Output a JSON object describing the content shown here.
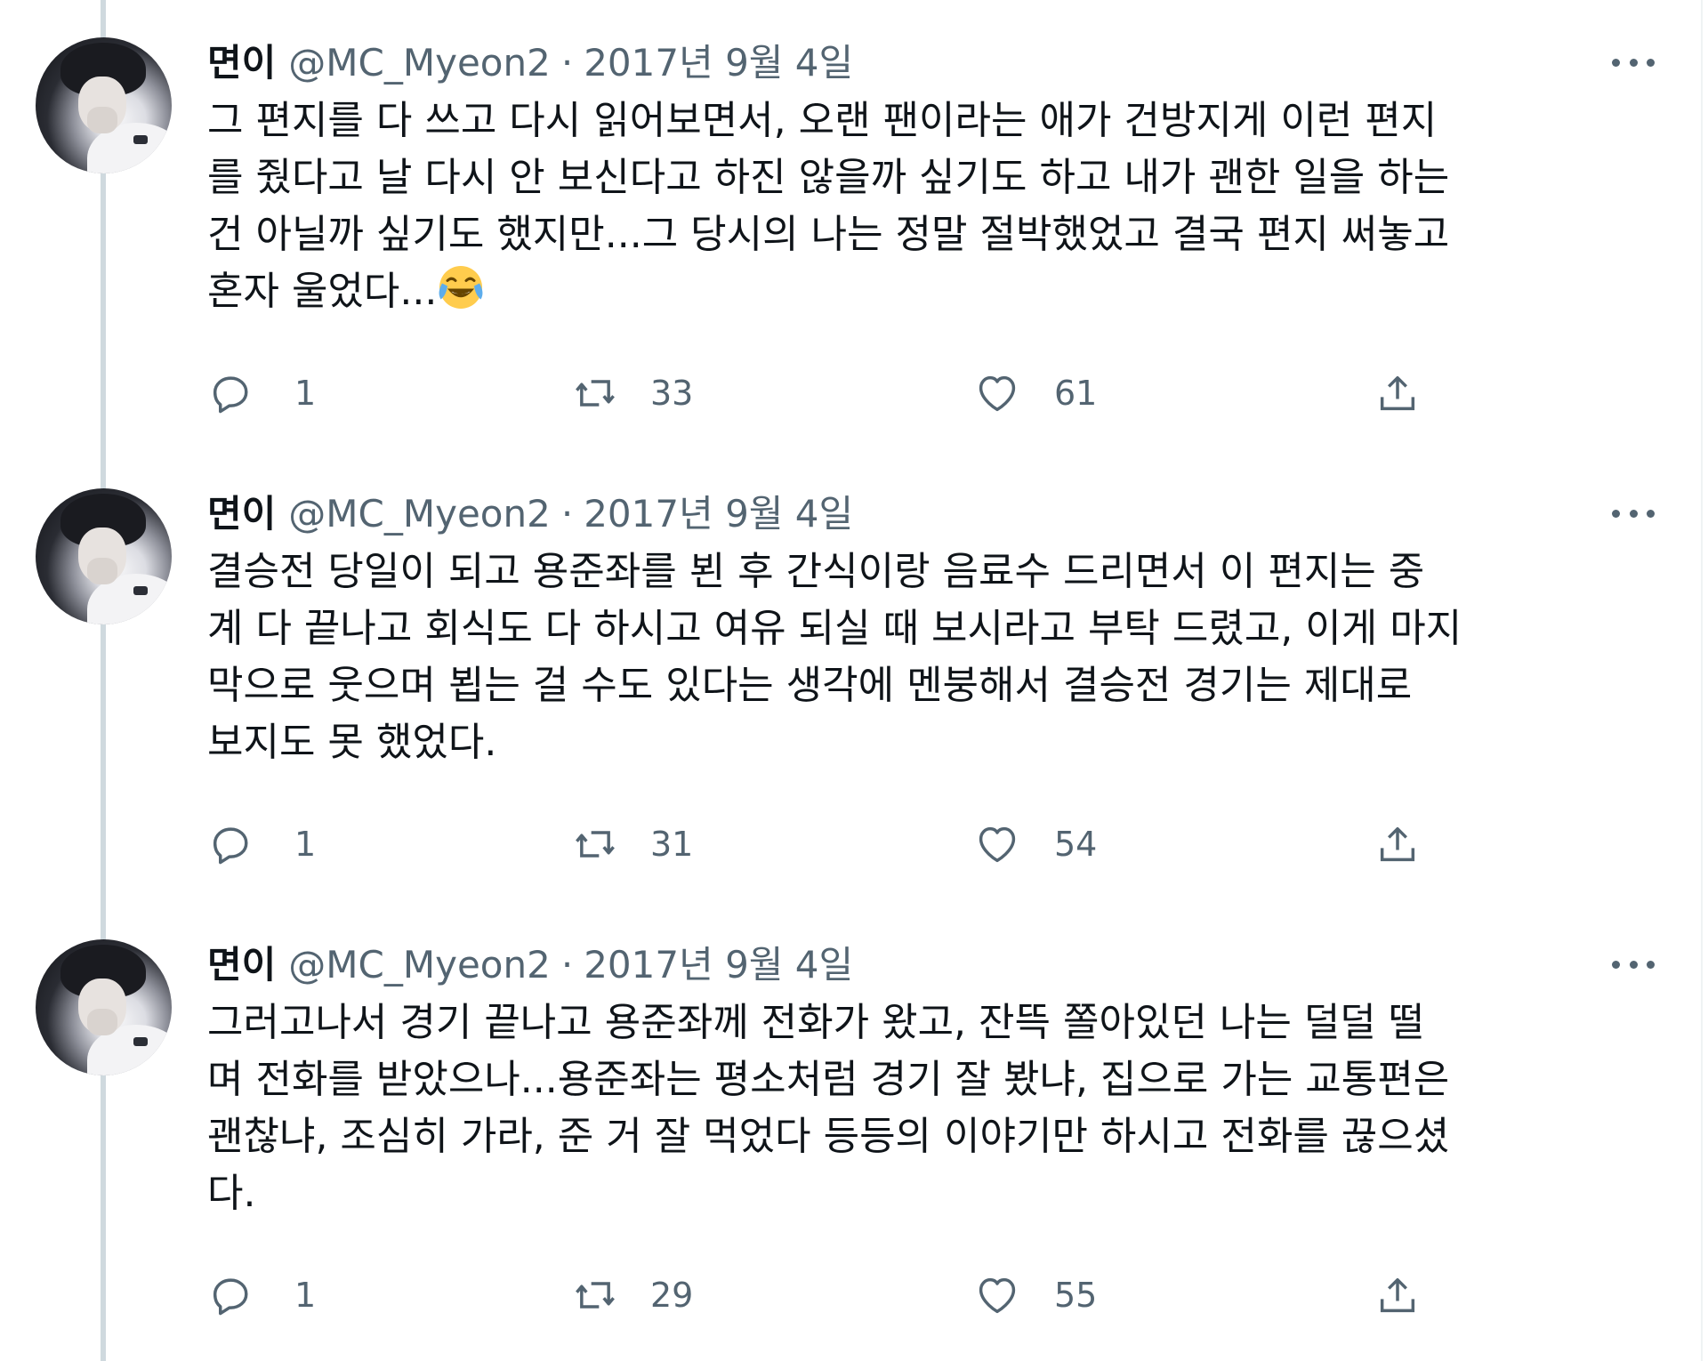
{
  "tweets": [
    {
      "author_name": "면이",
      "author_handle": "@MC_Myeon2",
      "separator": "·",
      "date": "2017년 9월 4일",
      "text": "그 편지를 다 쓰고 다시 읽어보면서, 오랜 팬이라는 애가 건방지게 이런 편지\n를 줬다고 날 다시 안 보신다고 하진 않을까 싶기도 하고 내가 괜한 일을 하는\n건 아닐까 싶기도 했지만...그 당시의 나는 정말 절박했었고 결국 편지 써놓고\n혼자 울었다...",
      "emoji": "face-with-tears-of-joy-icon",
      "replies": "1",
      "retweets": "33",
      "likes": "61"
    },
    {
      "author_name": "면이",
      "author_handle": "@MC_Myeon2",
      "separator": "·",
      "date": "2017년 9월 4일",
      "text": "결승전 당일이 되고 용준좌를 뵌 후 간식이랑 음료수 드리면서 이 편지는 중\n계 다 끝나고 회식도 다 하시고 여유 되실 때 보시라고 부탁 드렸고, 이게 마지\n막으로 웃으며 뵙는 걸 수도 있다는 생각에 멘붕해서 결승전 경기는 제대로\n보지도 못 했었다.",
      "replies": "1",
      "retweets": "31",
      "likes": "54"
    },
    {
      "author_name": "면이",
      "author_handle": "@MC_Myeon2",
      "separator": "·",
      "date": "2017년 9월 4일",
      "text": "그러고나서 경기 끝나고 용준좌께 전화가 왔고, 잔뜩 쫄아있던 나는 덜덜 떨\n며 전화를 받았으나...용준좌는 평소처럼 경기 잘 봤냐, 집으로 가는 교통편은\n괜찮냐, 조심히 가라, 준 거 잘 먹었다 등등의 이야기만 하시고 전화를 끊으셨\n다.",
      "replies": "1",
      "retweets": "29",
      "likes": "55"
    }
  ],
  "icons": {
    "reply": "reply-icon",
    "retweet": "retweet-icon",
    "like": "heart-icon",
    "share": "share-icon",
    "more": "more-icon"
  },
  "colors": {
    "text_primary": "#0f1419",
    "text_secondary": "#536471",
    "thread_line": "#cfd9de"
  }
}
